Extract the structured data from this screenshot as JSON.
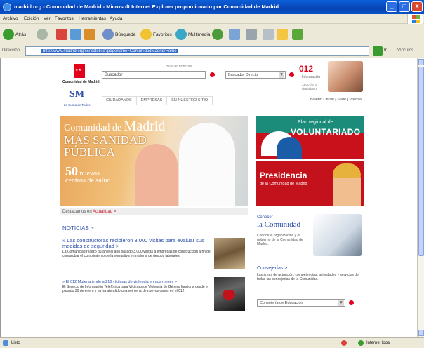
{
  "window": {
    "title": "madrid.org - Comunidad de Madrid - Microsoft Internet Explorer proporcionado por Comunidad de Madrid",
    "buttons": [
      "_",
      "□",
      "X"
    ]
  },
  "menu": [
    "Archivo",
    "Edición",
    "Ver",
    "Favoritos",
    "Herramientas",
    "Ayuda"
  ],
  "toolbar": {
    "back": "Atrás",
    "search": "Búsqueda",
    "favorites": "Favoritos",
    "multimedia": "Multimedia"
  },
  "address": {
    "label": "Dirección",
    "url": "http://www.madrid.org/cs/Satellite?pagename=ComunidadMadrid/Home",
    "go": "Ir",
    "links": "Vínculos"
  },
  "header": {
    "cm_name": "Comunidad de Madrid",
    "lsm_tag": "La Suma de Todos",
    "search_label": "Buscar noticias",
    "search_value": "Buscador",
    "select_value": "Buscador Directo",
    "n012": "012",
    "n012_sub": "Información",
    "n012_desc": "Atención al ciudadano",
    "tabs": [
      "CIUDADANOS",
      "EMPRESAS",
      "EN NUESTRO SITIO"
    ],
    "toplinks": "Boletín Oficial  |  Sede  |  Prensa"
  },
  "hero": {
    "line1_a": "Comunidad de",
    "line1_b": "Madrid",
    "line2": "MÁS SANIDAD PÚBLICA",
    "line3_num": "50",
    "line3_txt": "nuevos centros de salud"
  },
  "volun": {
    "t1": "Plan regional de",
    "t2": "VOLUNTARIADO"
  },
  "presi": {
    "t1": "Presidencia",
    "t2": "de la Comunidad de Madrid"
  },
  "content": {
    "dest_prefix": "Destacamos en",
    "dest_link": "Actualidad >",
    "noticias": "NOTICIAS >",
    "news": [
      {
        "headline": "» Las constructoras recibieron 3.000 visitas para evaluar sus medidas de seguridad >",
        "body": "La Comunidad realizó durante el año pasado 3.000 visitas a empresas de construcción a fin de comprobar el cumplimiento de la normativa en materia de riesgos laborales."
      },
      {
        "headline": "» El 012 Mujer atiende a 216 víctimas de violencia en dos meses >",
        "body": "El Servicio de Información Telefónica para Víctimas de Violencia de Género funciona desde el pasado 30 de enero y ya ha atendido una veintena de nuevos casos en el 012."
      }
    ]
  },
  "know": {
    "k1": "Conocer",
    "k2": "la Comunidad",
    "k3": "Conoce la organización y el gobierno de la Comunidad de Madrid.",
    "cons": "Consejerías >",
    "consd": "Las áreas de actuación, competencias, actividades y servicios de todas las consejerías de la Comunidad.",
    "select": "Consejería de Educación"
  },
  "status": {
    "left": "Listo",
    "right": "Internet local"
  }
}
